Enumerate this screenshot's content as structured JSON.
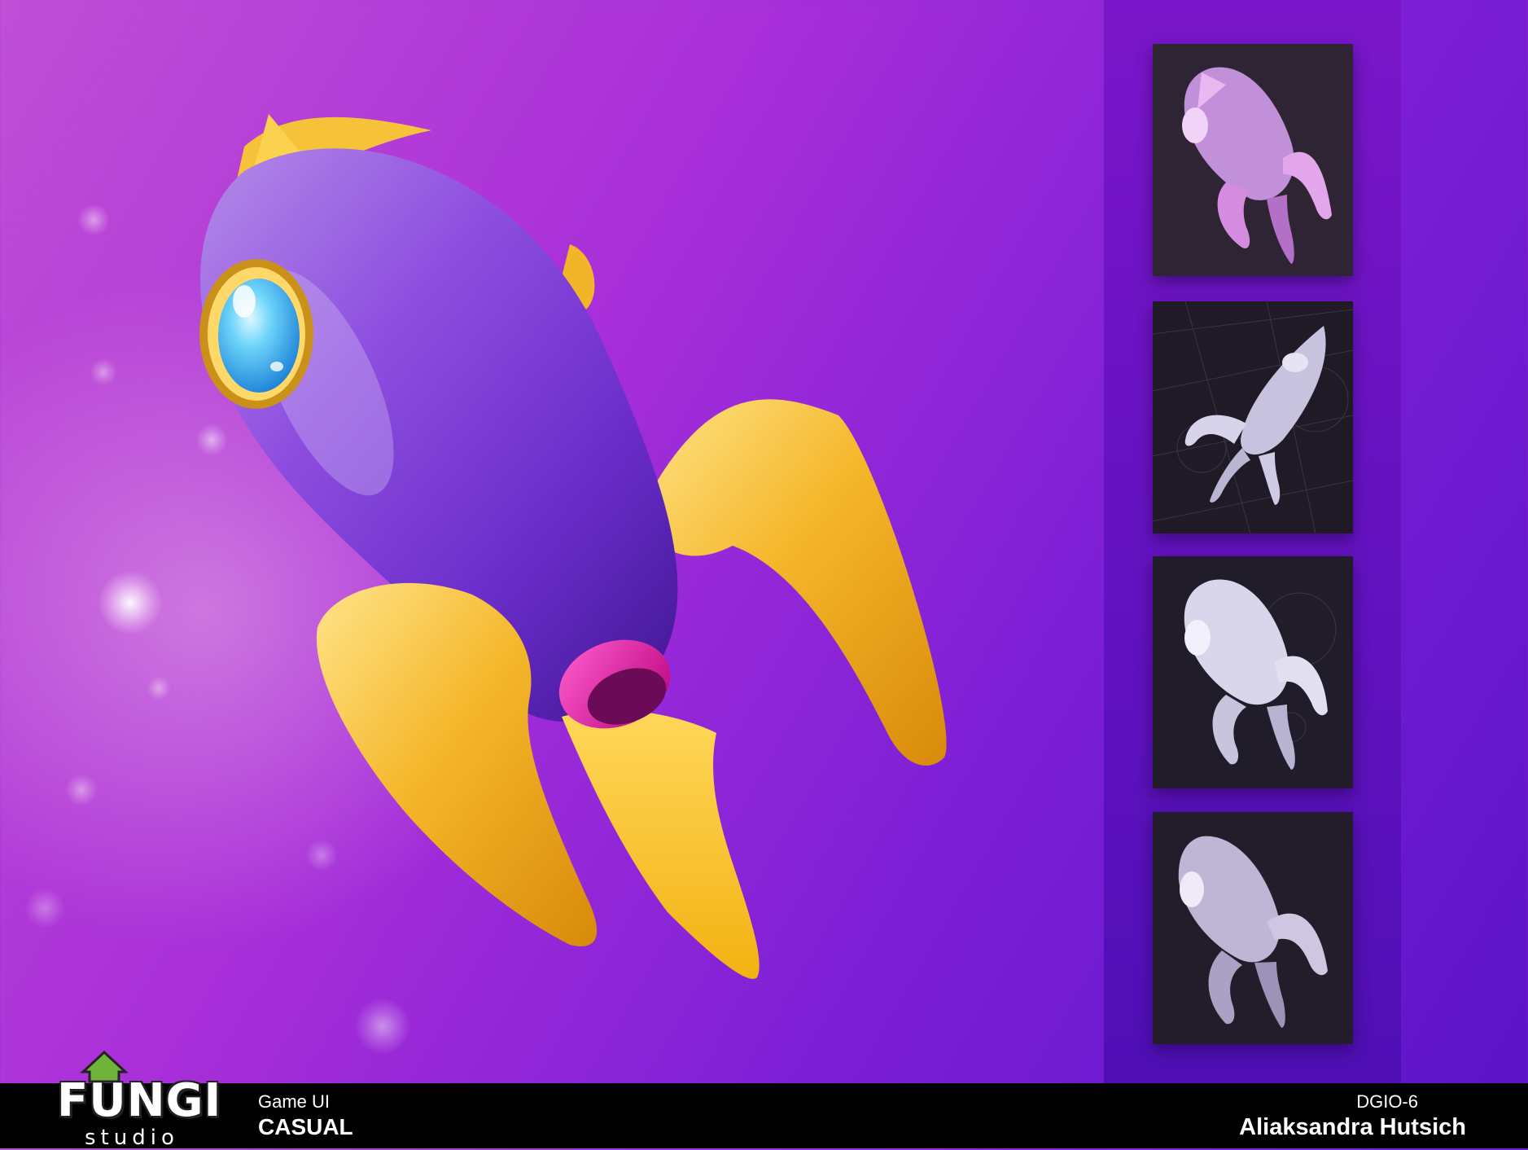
{
  "brand": {
    "logo_word": "FUNGI",
    "logo_sub": "studio"
  },
  "footer": {
    "category": "Game UI",
    "subcategory": "CASUAL",
    "code": "DGIO-6",
    "author": "Aliaksandra Hutsich"
  },
  "colors": {
    "body": "#7a2fd0",
    "fins": "#f2b52a",
    "window_glass": "#4fc8f5",
    "nozzle": "#e3119b",
    "sidebar": "#6a14c4",
    "footer": "#000000"
  },
  "hero": {
    "icon": "rocket-icon"
  },
  "thumbnails": [
    {
      "name": "rocket-sketch-pink"
    },
    {
      "name": "rocket-model-grid"
    },
    {
      "name": "rocket-model-lit"
    },
    {
      "name": "rocket-model-dark"
    }
  ]
}
